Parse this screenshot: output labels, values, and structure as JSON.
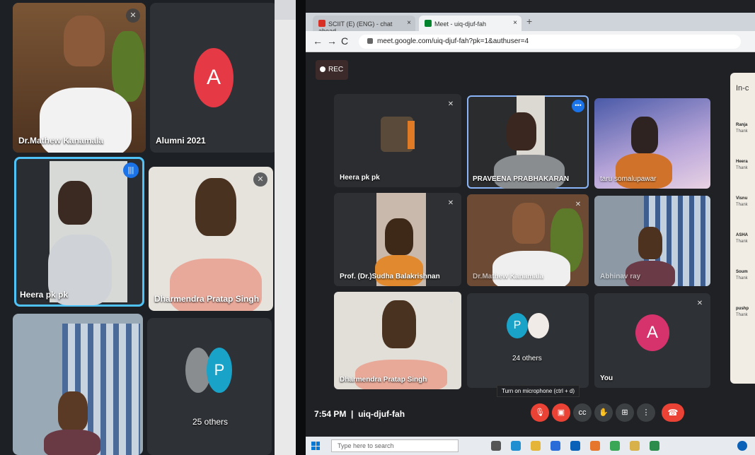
{
  "left_meeting": {
    "tiles": [
      {
        "name": "Dr.Mathew Kanamala"
      },
      {
        "name": "Alumni 2021",
        "avatar_letter": "A"
      },
      {
        "name": "Heera pk pk"
      },
      {
        "name": "Dharmendra Pratap Singh"
      },
      {
        "name": ""
      },
      {
        "name": "25 others",
        "avatar_letter": "P"
      }
    ]
  },
  "browser": {
    "tabs": [
      {
        "label": "SCIIT (E) (ENG) - chat ahead..."
      },
      {
        "label": "Meet - uiq-djuf-fah"
      }
    ],
    "url": "meet.google.com/uiq-djuf-fah?pk=1&authuser=4"
  },
  "meet": {
    "rec_label": "REC",
    "tiles": [
      {
        "name": "Heera pk pk"
      },
      {
        "name": "PRAVEENA PRABHAKARAN"
      },
      {
        "name": "taru somalupawar"
      },
      {
        "name": "Prof. (Dr.)Sudha Balakrishnan"
      },
      {
        "name": "Dr.Mathew Kanamala"
      },
      {
        "name": "Abhinav ray"
      },
      {
        "name": "Dharmendra Pratap Singh"
      },
      {
        "name": "24 others",
        "avatar_letter": "P"
      },
      {
        "name": "You",
        "avatar_letter": "A"
      }
    ],
    "side_panel": {
      "title": "In-c",
      "messages": [
        {
          "sender": "Ranja",
          "text": "Thank"
        },
        {
          "sender": "Heera",
          "text": "Thank"
        },
        {
          "sender": "Visnu",
          "text": "Thank"
        },
        {
          "sender": "ASHA",
          "text": "Thank"
        },
        {
          "sender": "Soum",
          "text": "Thank"
        },
        {
          "sender": "pushp",
          "text": "Thank"
        }
      ]
    },
    "time": "7:54 PM",
    "meeting_code": "uiq-djuf-fah",
    "tooltip": "Turn on microphone (ctrl + d)"
  },
  "taskbar": {
    "search_placeholder": "Type here to search"
  },
  "colors": {
    "meet_bg": "#202124",
    "tile_bg": "#3c4043",
    "active_outline": "#8ab4f8",
    "danger_red": "#ea4335",
    "avatar_red": "#e53945",
    "avatar_teal": "#1aa3c8",
    "avatar_pink": "#d6336c"
  }
}
